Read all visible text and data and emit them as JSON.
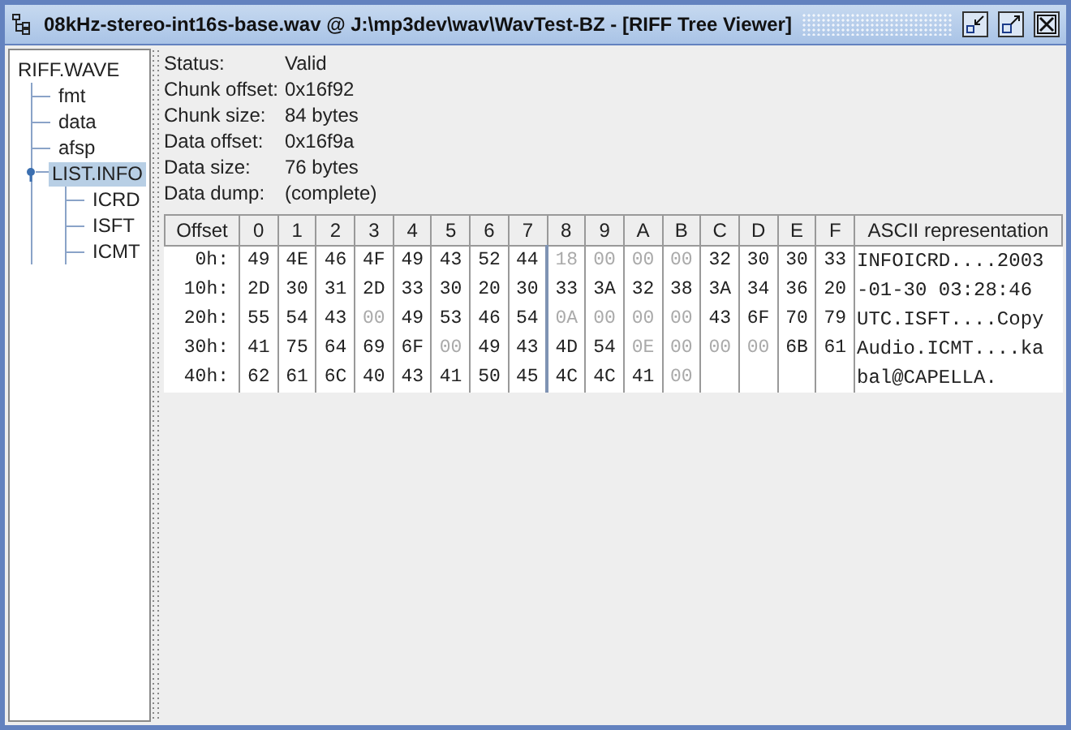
{
  "window": {
    "title": "08kHz-stereo-int16s-base.wav @ J:\\mp3dev\\wav\\WavTest-BZ - [RIFF Tree Viewer]"
  },
  "tree": {
    "label": "RIFF.WAVE",
    "selected": false,
    "children": [
      {
        "label": "fmt",
        "selected": false
      },
      {
        "label": "data",
        "selected": false
      },
      {
        "label": "afsp",
        "selected": false
      },
      {
        "label": "LIST.INFO",
        "selected": true,
        "expanded": true,
        "children": [
          {
            "label": "ICRD",
            "selected": false
          },
          {
            "label": "ISFT",
            "selected": false
          },
          {
            "label": "ICMT",
            "selected": false
          }
        ]
      }
    ]
  },
  "details": [
    {
      "label": "Status:",
      "value": "Valid"
    },
    {
      "label": "Chunk offset:",
      "value": "0x16f92"
    },
    {
      "label": "Chunk size:",
      "value": "84 bytes"
    },
    {
      "label": "Data offset:",
      "value": "0x16f9a"
    },
    {
      "label": "Data size:",
      "value": "76 bytes"
    },
    {
      "label": "Data dump:",
      "value": "(complete)"
    }
  ],
  "hex_table": {
    "columns": [
      "Offset",
      "0",
      "1",
      "2",
      "3",
      "4",
      "5",
      "6",
      "7",
      "8",
      "9",
      "A",
      "B",
      "C",
      "D",
      "E",
      "F",
      "ASCII representation"
    ],
    "rows": [
      {
        "offset": "0h:",
        "bytes": [
          {
            "text": "49",
            "dim": false
          },
          {
            "text": "4E",
            "dim": false
          },
          {
            "text": "46",
            "dim": false
          },
          {
            "text": "4F",
            "dim": false
          },
          {
            "text": "49",
            "dim": false
          },
          {
            "text": "43",
            "dim": false
          },
          {
            "text": "52",
            "dim": false
          },
          {
            "text": "44",
            "dim": false
          },
          {
            "text": "18",
            "dim": true
          },
          {
            "text": "00",
            "dim": true
          },
          {
            "text": "00",
            "dim": true
          },
          {
            "text": "00",
            "dim": true
          },
          {
            "text": "32",
            "dim": false
          },
          {
            "text": "30",
            "dim": false
          },
          {
            "text": "30",
            "dim": false
          },
          {
            "text": "33",
            "dim": false
          }
        ],
        "ascii": "INFOICRD....2003"
      },
      {
        "offset": "10h:",
        "bytes": [
          {
            "text": "2D",
            "dim": false
          },
          {
            "text": "30",
            "dim": false
          },
          {
            "text": "31",
            "dim": false
          },
          {
            "text": "2D",
            "dim": false
          },
          {
            "text": "33",
            "dim": false
          },
          {
            "text": "30",
            "dim": false
          },
          {
            "text": "20",
            "dim": false
          },
          {
            "text": "30",
            "dim": false
          },
          {
            "text": "33",
            "dim": false
          },
          {
            "text": "3A",
            "dim": false
          },
          {
            "text": "32",
            "dim": false
          },
          {
            "text": "38",
            "dim": false
          },
          {
            "text": "3A",
            "dim": false
          },
          {
            "text": "34",
            "dim": false
          },
          {
            "text": "36",
            "dim": false
          },
          {
            "text": "20",
            "dim": false
          }
        ],
        "ascii": "-01-30 03:28:46"
      },
      {
        "offset": "20h:",
        "bytes": [
          {
            "text": "55",
            "dim": false
          },
          {
            "text": "54",
            "dim": false
          },
          {
            "text": "43",
            "dim": false
          },
          {
            "text": "00",
            "dim": true
          },
          {
            "text": "49",
            "dim": false
          },
          {
            "text": "53",
            "dim": false
          },
          {
            "text": "46",
            "dim": false
          },
          {
            "text": "54",
            "dim": false
          },
          {
            "text": "0A",
            "dim": true
          },
          {
            "text": "00",
            "dim": true
          },
          {
            "text": "00",
            "dim": true
          },
          {
            "text": "00",
            "dim": true
          },
          {
            "text": "43",
            "dim": false
          },
          {
            "text": "6F",
            "dim": false
          },
          {
            "text": "70",
            "dim": false
          },
          {
            "text": "79",
            "dim": false
          }
        ],
        "ascii": "UTC.ISFT....Copy"
      },
      {
        "offset": "30h:",
        "bytes": [
          {
            "text": "41",
            "dim": false
          },
          {
            "text": "75",
            "dim": false
          },
          {
            "text": "64",
            "dim": false
          },
          {
            "text": "69",
            "dim": false
          },
          {
            "text": "6F",
            "dim": false
          },
          {
            "text": "00",
            "dim": true
          },
          {
            "text": "49",
            "dim": false
          },
          {
            "text": "43",
            "dim": false
          },
          {
            "text": "4D",
            "dim": false
          },
          {
            "text": "54",
            "dim": false
          },
          {
            "text": "0E",
            "dim": true
          },
          {
            "text": "00",
            "dim": true
          },
          {
            "text": "00",
            "dim": true
          },
          {
            "text": "00",
            "dim": true
          },
          {
            "text": "6B",
            "dim": false
          },
          {
            "text": "61",
            "dim": false
          }
        ],
        "ascii": "Audio.ICMT....ka"
      },
      {
        "offset": "40h:",
        "bytes": [
          {
            "text": "62",
            "dim": false
          },
          {
            "text": "61",
            "dim": false
          },
          {
            "text": "6C",
            "dim": false
          },
          {
            "text": "40",
            "dim": false
          },
          {
            "text": "43",
            "dim": false
          },
          {
            "text": "41",
            "dim": false
          },
          {
            "text": "50",
            "dim": false
          },
          {
            "text": "45",
            "dim": false
          },
          {
            "text": "4C",
            "dim": false
          },
          {
            "text": "4C",
            "dim": false
          },
          {
            "text": "41",
            "dim": false
          },
          {
            "text": "00",
            "dim": true
          }
        ],
        "ascii": "bal@CAPELLA."
      }
    ]
  }
}
